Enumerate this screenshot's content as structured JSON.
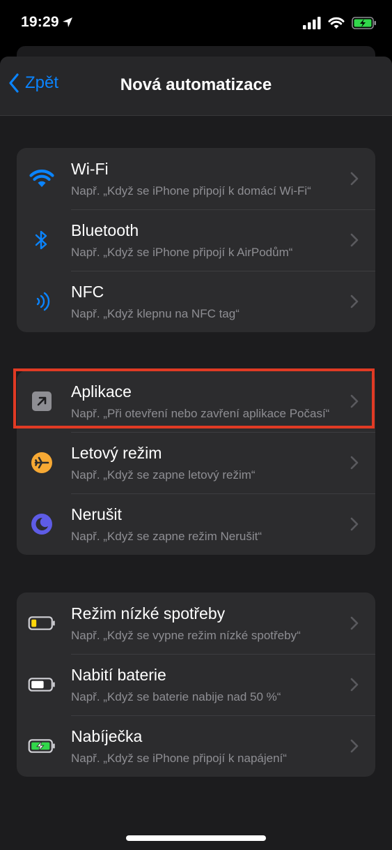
{
  "status_bar": {
    "time": "19:29"
  },
  "nav": {
    "back_label": "Zpět",
    "title": "Nová automatizace"
  },
  "groups": [
    {
      "rows": [
        {
          "title": "Wi-Fi",
          "subtitle": "Např. „Když se iPhone připojí k domácí Wi-Fi“",
          "icon": "wifi-icon"
        },
        {
          "title": "Bluetooth",
          "subtitle": "Např. „Když se iPhone připojí k AirPodům“",
          "icon": "bluetooth-icon"
        },
        {
          "title": "NFC",
          "subtitle": "Např. „Když klepnu na NFC tag“",
          "icon": "nfc-icon"
        }
      ]
    },
    {
      "rows": [
        {
          "title": "Aplikace",
          "subtitle": "Např. „Při otevření nebo zavření aplikace Počasí“",
          "icon": "app-arrow-icon"
        },
        {
          "title": "Letový režim",
          "subtitle": "Např. „Když se zapne letový režim“",
          "icon": "airplane-icon"
        },
        {
          "title": "Nerušit",
          "subtitle": "Např. „Když se zapne režim Nerušit“",
          "icon": "moon-icon"
        }
      ]
    },
    {
      "rows": [
        {
          "title": "Režim nízké spotřeby",
          "subtitle": "Např. „Když se vypne režim nízké spotřeby“",
          "icon": "low-battery-icon"
        },
        {
          "title": "Nabití baterie",
          "subtitle": "Např. „Když se baterie nabije nad 50 %“",
          "icon": "battery-icon"
        },
        {
          "title": "Nabíječka",
          "subtitle": "Např. „Když se iPhone připojí k napájení“",
          "icon": "charging-battery-icon"
        }
      ]
    }
  ],
  "colors": {
    "accent": "#0a84ff",
    "highlight": "#e03a24",
    "airplane": "#f7a934",
    "moon": "#5e5ce6",
    "battery_low": "#ffd60a",
    "battery_charging": "#32d74b"
  }
}
